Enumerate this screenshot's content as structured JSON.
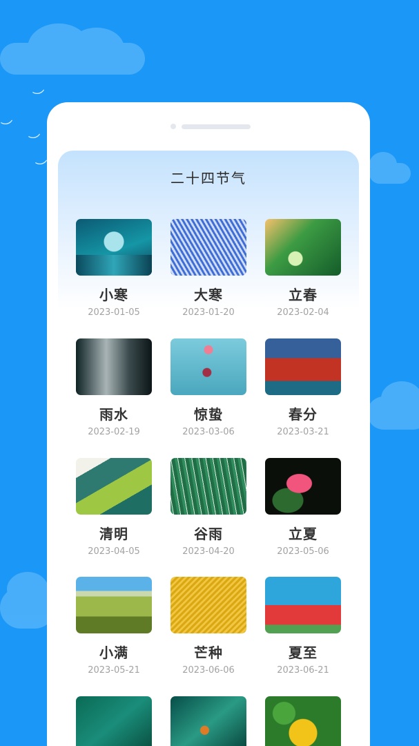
{
  "panel": {
    "title": "二十四节气"
  },
  "terms": [
    {
      "name": "小寒",
      "date": "2023-01-05",
      "image": "frost-bubble-image"
    },
    {
      "name": "大寒",
      "date": "2023-01-20",
      "image": "frost-crystals-image"
    },
    {
      "name": "立春",
      "date": "2023-02-04",
      "image": "butterfly-flower-image"
    },
    {
      "name": "雨水",
      "date": "2023-02-19",
      "image": "water-drop-image"
    },
    {
      "name": "惊蛰",
      "date": "2023-03-06",
      "image": "hummingbird-image"
    },
    {
      "name": "春分",
      "date": "2023-03-21",
      "image": "blossom-wall-image"
    },
    {
      "name": "清明",
      "date": "2023-04-05",
      "image": "green-leaf-image"
    },
    {
      "name": "谷雨",
      "date": "2023-04-20",
      "image": "grass-rain-image"
    },
    {
      "name": "立夏",
      "date": "2023-05-06",
      "image": "lotus-image"
    },
    {
      "name": "小满",
      "date": "2023-05-21",
      "image": "wheat-field-image"
    },
    {
      "name": "芒种",
      "date": "2023-06-06",
      "image": "rapeseed-image"
    },
    {
      "name": "夏至",
      "date": "2023-06-21",
      "image": "watermelon-image"
    },
    {
      "name": "",
      "date": "",
      "image": "dragonfly-image"
    },
    {
      "name": "",
      "date": "",
      "image": "koi-lotus-leaf-image"
    },
    {
      "name": "",
      "date": "",
      "image": "ginkgo-leaf-image"
    }
  ]
}
